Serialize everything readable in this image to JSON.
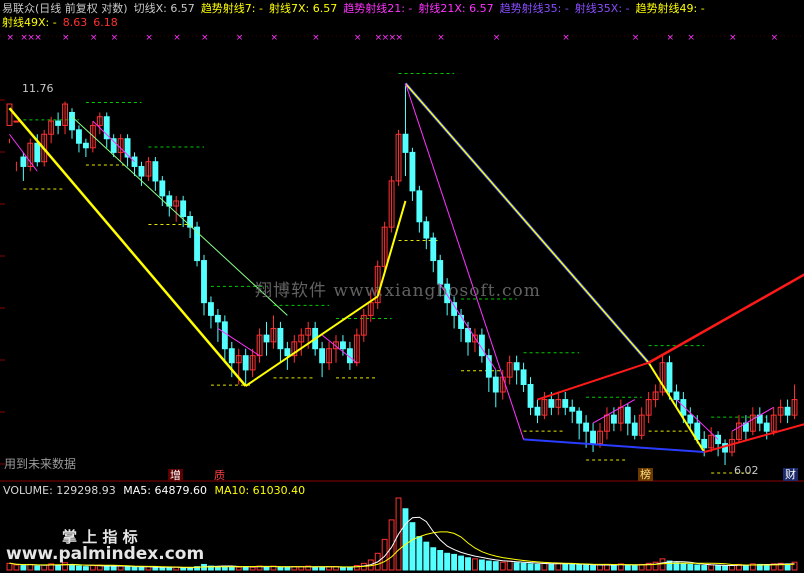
{
  "header": {
    "line1": [
      {
        "text": "易联众(日线 前复权 对数)",
        "color": "#c8c8c8"
      },
      {
        "text": "切线X: 6.57",
        "color": "#c8c8c8"
      },
      {
        "text": "趋势射线7: -",
        "color": "#ffff00"
      },
      {
        "text": "射线7X: 6.57",
        "color": "#ffff00"
      },
      {
        "text": "趋势射线21: -",
        "color": "#ff33ff"
      },
      {
        "text": "射线21X: 6.57",
        "color": "#ff33ff"
      },
      {
        "text": "趋势射线35: -",
        "color": "#8a4dff"
      },
      {
        "text": "射线35X: -",
        "color": "#8a4dff"
      },
      {
        "text": "趋势射线49: -",
        "color": "#ffff00"
      }
    ],
    "line2": [
      {
        "text": "射线49X: -",
        "color": "#ffff00"
      },
      {
        "text": "8.63",
        "color": "#ff3030"
      },
      {
        "text": "6.18",
        "color": "#ff3030"
      }
    ]
  },
  "annotations": {
    "high_price": "11.76",
    "low_price": "6.02",
    "future_data_note": "用到未来数据",
    "badge_zeng": "增",
    "badge_zhi": "质",
    "badge_bang": "榜",
    "badge_cai": "财"
  },
  "watermarks": {
    "main": "翔博软件 www.xiangbosoft.com",
    "vol_title": "掌 上 指 标",
    "vol_url": "www.palmindex.com"
  },
  "volume_header": {
    "volume_label": "VOLUME: 129298.93",
    "ma5_label": "MA5: 64879.60",
    "ma10_label": "MA10: 61030.40"
  },
  "colors": {
    "up": "#ff3232",
    "down": "#54ffff",
    "yellow": "#ffff00",
    "magenta": "#ff33ff",
    "blue": "#2a3cff",
    "red_line": "#ff1a1a",
    "green_dash": "#00cc00",
    "ma5": "#ffffff",
    "ma10": "#ffff00"
  },
  "chart_data": {
    "type": "candlestick",
    "title": "易联众(日线 前复权 对数)",
    "y_scale": "log",
    "price_range": [
      5.6,
      12.8
    ],
    "candles": [
      [
        11.2,
        11.7,
        10.9,
        10.8
      ],
      [
        11.3,
        11.3,
        10.4,
        10.2
      ],
      [
        10.5,
        10.3,
        10.0,
        10.6
      ],
      [
        10.3,
        10.8,
        10.2,
        10.9
      ],
      [
        10.8,
        10.4,
        10.3,
        11.0
      ],
      [
        10.4,
        11.0,
        10.3,
        11.1
      ],
      [
        11.0,
        11.3,
        10.8,
        11.4
      ],
      [
        11.3,
        11.2,
        11.0,
        11.5
      ],
      [
        11.2,
        11.7,
        11.0,
        11.76
      ],
      [
        11.5,
        11.1,
        10.9,
        11.6
      ],
      [
        11.1,
        10.8,
        10.6,
        11.2
      ],
      [
        10.8,
        10.7,
        10.5,
        10.9
      ],
      [
        10.7,
        11.2,
        10.6,
        11.3
      ],
      [
        11.2,
        11.4,
        11.0,
        11.5
      ],
      [
        11.4,
        10.9,
        10.7,
        11.5
      ],
      [
        10.9,
        10.6,
        10.5,
        11.0
      ],
      [
        10.6,
        10.9,
        10.4,
        11.0
      ],
      [
        10.9,
        10.5,
        10.3,
        11.0
      ],
      [
        10.5,
        10.3,
        10.1,
        10.6
      ],
      [
        10.3,
        10.1,
        9.9,
        10.4
      ],
      [
        10.1,
        10.4,
        10.0,
        10.5
      ],
      [
        10.4,
        10.0,
        9.8,
        10.5
      ],
      [
        10.0,
        9.7,
        9.5,
        10.1
      ],
      [
        9.7,
        9.5,
        9.3,
        9.8
      ],
      [
        9.5,
        9.6,
        9.2,
        9.7
      ],
      [
        9.6,
        9.3,
        9.1,
        9.7
      ],
      [
        9.3,
        9.1,
        8.9,
        9.4
      ],
      [
        9.1,
        8.5,
        8.4,
        9.2
      ],
      [
        8.5,
        7.8,
        7.6,
        8.6
      ],
      [
        7.8,
        7.6,
        7.4,
        7.9
      ],
      [
        7.6,
        7.5,
        7.2,
        7.7
      ],
      [
        7.5,
        7.1,
        6.9,
        7.6
      ],
      [
        7.1,
        6.9,
        6.7,
        7.2
      ],
      [
        6.9,
        7.0,
        6.6,
        7.1
      ],
      [
        7.0,
        6.8,
        6.58,
        7.1
      ],
      [
        6.8,
        7.0,
        6.7,
        7.1
      ],
      [
        7.0,
        7.3,
        6.9,
        7.4
      ],
      [
        7.3,
        7.2,
        7.0,
        7.5
      ],
      [
        7.2,
        7.4,
        7.1,
        7.6
      ],
      [
        7.4,
        7.1,
        6.9,
        7.5
      ],
      [
        7.1,
        7.0,
        6.8,
        7.2
      ],
      [
        7.0,
        7.2,
        6.9,
        7.3
      ],
      [
        7.2,
        7.3,
        7.0,
        7.4
      ],
      [
        7.3,
        7.4,
        7.1,
        7.5
      ],
      [
        7.4,
        7.1,
        7.0,
        7.5
      ],
      [
        7.1,
        6.9,
        6.7,
        7.2
      ],
      [
        6.9,
        7.1,
        6.8,
        7.2
      ],
      [
        7.1,
        7.2,
        6.9,
        7.3
      ],
      [
        7.2,
        7.1,
        7.0,
        7.3
      ],
      [
        7.1,
        6.9,
        6.8,
        7.2
      ],
      [
        6.9,
        7.3,
        6.85,
        7.4
      ],
      [
        7.3,
        7.6,
        7.2,
        7.7
      ],
      [
        7.6,
        7.8,
        7.5,
        8.0
      ],
      [
        7.8,
        8.4,
        7.7,
        8.5
      ],
      [
        8.4,
        9.1,
        8.3,
        9.2
      ],
      [
        9.1,
        10.0,
        9.0,
        10.1
      ],
      [
        10.0,
        11.0,
        9.9,
        11.1
      ],
      [
        11.0,
        10.6,
        10.1,
        12.2
      ],
      [
        10.6,
        9.8,
        9.6,
        10.7
      ],
      [
        9.8,
        9.2,
        9.0,
        9.9
      ],
      [
        9.2,
        8.9,
        8.7,
        9.3
      ],
      [
        8.9,
        8.5,
        8.3,
        9.0
      ],
      [
        8.5,
        8.1,
        7.9,
        8.6
      ],
      [
        8.1,
        7.8,
        7.6,
        8.2
      ],
      [
        7.8,
        7.6,
        7.4,
        7.9
      ],
      [
        7.6,
        7.4,
        7.2,
        7.7
      ],
      [
        7.4,
        7.2,
        7.0,
        7.5
      ],
      [
        7.2,
        7.3,
        7.05,
        7.4
      ],
      [
        7.3,
        7.0,
        6.9,
        7.4
      ],
      [
        7.0,
        6.7,
        6.5,
        7.1
      ],
      [
        6.7,
        6.5,
        6.3,
        6.8
      ],
      [
        6.5,
        6.7,
        6.4,
        6.8
      ],
      [
        6.7,
        6.9,
        6.6,
        7.0
      ],
      [
        6.9,
        6.8,
        6.6,
        7.0
      ],
      [
        6.8,
        6.6,
        6.5,
        6.9
      ],
      [
        6.6,
        6.3,
        6.2,
        6.7
      ],
      [
        6.3,
        6.2,
        6.1,
        6.4
      ],
      [
        6.2,
        6.4,
        6.15,
        6.5
      ],
      [
        6.4,
        6.3,
        6.2,
        6.5
      ],
      [
        6.3,
        6.4,
        6.2,
        6.5
      ],
      [
        6.4,
        6.3,
        6.2,
        6.5
      ],
      [
        6.3,
        6.25,
        6.1,
        6.4
      ],
      [
        6.25,
        6.1,
        5.9,
        6.3
      ],
      [
        6.1,
        6.0,
        5.8,
        6.2
      ],
      [
        6.0,
        5.85,
        5.75,
        6.1
      ],
      [
        5.85,
        6.0,
        5.8,
        6.1
      ],
      [
        6.0,
        6.2,
        5.9,
        6.3
      ],
      [
        6.2,
        6.1,
        6.0,
        6.3
      ],
      [
        6.1,
        6.3,
        6.0,
        6.4
      ],
      [
        6.3,
        6.1,
        5.95,
        6.35
      ],
      [
        6.1,
        5.95,
        5.9,
        6.2
      ],
      [
        5.95,
        6.2,
        5.9,
        6.3
      ],
      [
        6.2,
        6.4,
        6.1,
        6.5
      ],
      [
        6.4,
        6.5,
        6.3,
        6.6
      ],
      [
        6.5,
        6.9,
        6.45,
        7.0
      ],
      [
        6.9,
        6.5,
        6.4,
        7.0
      ],
      [
        6.5,
        6.4,
        6.3,
        6.6
      ],
      [
        6.4,
        6.2,
        6.1,
        6.5
      ],
      [
        6.2,
        6.1,
        6.0,
        6.3
      ],
      [
        6.1,
        5.9,
        5.85,
        6.2
      ],
      [
        5.9,
        5.8,
        5.7,
        6.0
      ],
      [
        5.8,
        5.95,
        5.75,
        6.05
      ],
      [
        5.95,
        5.85,
        5.7,
        6.0
      ],
      [
        5.85,
        5.75,
        5.6,
        5.9
      ],
      [
        5.75,
        5.9,
        5.7,
        6.0
      ],
      [
        5.9,
        6.1,
        5.85,
        6.2
      ],
      [
        6.1,
        6.0,
        5.9,
        6.2
      ],
      [
        6.0,
        6.2,
        5.95,
        6.3
      ],
      [
        6.2,
        6.1,
        6.0,
        6.3
      ],
      [
        6.1,
        6.0,
        5.9,
        6.2
      ],
      [
        6.0,
        6.2,
        5.95,
        6.3
      ],
      [
        6.2,
        6.3,
        6.1,
        6.4
      ],
      [
        6.3,
        6.2,
        6.1,
        6.4
      ],
      [
        6.2,
        6.4,
        6.15,
        6.6
      ]
    ],
    "volume": [
      12000,
      9000,
      8000,
      10000,
      7000,
      9000,
      11000,
      8000,
      13000,
      9000,
      7000,
      6000,
      8000,
      9000,
      7000,
      6000,
      7000,
      6000,
      5000,
      5000,
      6000,
      5000,
      4000,
      4000,
      5000,
      4000,
      4000,
      6000,
      10000,
      7000,
      6000,
      7000,
      6000,
      5000,
      6000,
      5000,
      7000,
      6000,
      7000,
      5000,
      5000,
      6000,
      6000,
      7000,
      5000,
      5000,
      6000,
      6000,
      5000,
      5000,
      8000,
      12000,
      18000,
      30000,
      55000,
      90000,
      129299,
      110000,
      85000,
      60000,
      50000,
      40000,
      35000,
      30000,
      28000,
      25000,
      22000,
      20000,
      18000,
      16000,
      15000,
      14000,
      16000,
      13000,
      12000,
      11000,
      10000,
      12000,
      11000,
      12000,
      11000,
      10000,
      9000,
      9000,
      8000,
      9000,
      10000,
      9000,
      11000,
      9000,
      8000,
      10000,
      12000,
      14000,
      20000,
      16000,
      13000,
      11000,
      10000,
      9000,
      8000,
      9000,
      8000,
      7000,
      8000,
      10000,
      9000,
      11000,
      10000,
      9000,
      11000,
      12000,
      11000,
      14000
    ],
    "ma5_last": 64879.6,
    "ma10_last": 61030.4
  }
}
